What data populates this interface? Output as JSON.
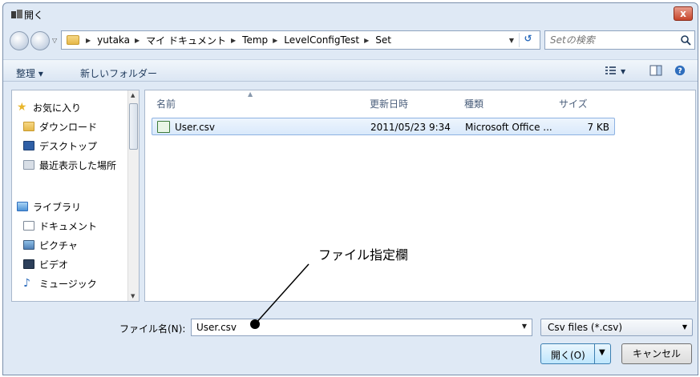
{
  "window": {
    "title": "開く",
    "close_label": "x"
  },
  "nav": {
    "breadcrumbs": [
      "yutaka",
      "マイ ドキュメント",
      "Temp",
      "LevelConfigTest",
      "Set"
    ],
    "search_placeholder": "Setの検索"
  },
  "toolbar": {
    "organize": "整理 ▾",
    "new_folder": "新しいフォルダー"
  },
  "sidebar": {
    "items": [
      {
        "label": "お気に入り",
        "icon": "star-icon"
      },
      {
        "label": "ダウンロード",
        "icon": "download-folder-icon"
      },
      {
        "label": "デスクトップ",
        "icon": "desktop-icon"
      },
      {
        "label": "最近表示した場所",
        "icon": "recent-places-icon"
      },
      {
        "label": "ライブラリ",
        "icon": "library-icon"
      },
      {
        "label": "ドキュメント",
        "icon": "document-icon"
      },
      {
        "label": "ピクチャ",
        "icon": "picture-icon"
      },
      {
        "label": "ビデオ",
        "icon": "video-icon"
      },
      {
        "label": "ミュージック",
        "icon": "music-icon"
      }
    ]
  },
  "file_list": {
    "columns": [
      "名前",
      "更新日時",
      "種類",
      "サイズ"
    ],
    "rows": [
      {
        "name": "User.csv",
        "date": "2011/05/23 9:34",
        "type": "Microsoft Office ...",
        "size": "7 KB"
      }
    ]
  },
  "footer": {
    "filename_label": "ファイル名(N):",
    "filename_value": "User.csv",
    "filter_value": "Csv files (*.csv)",
    "open_label": "開く(O)",
    "cancel_label": "キャンセル"
  },
  "annotation": {
    "text": "ファイル指定欄"
  }
}
